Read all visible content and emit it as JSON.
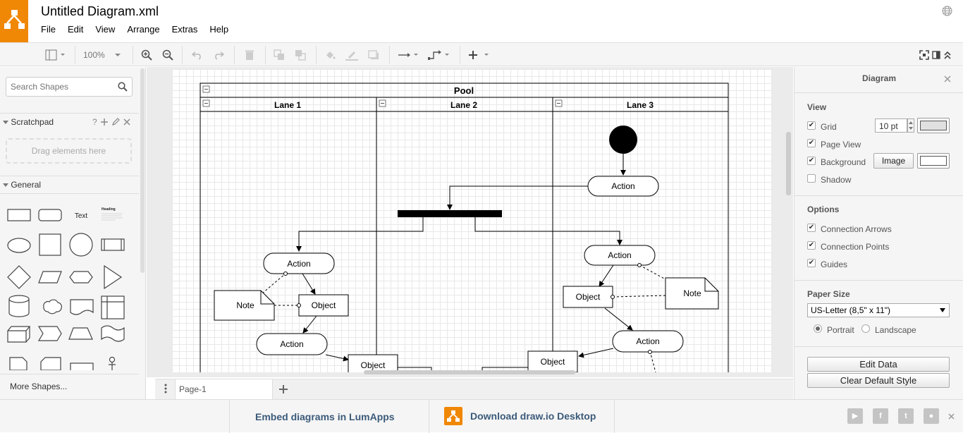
{
  "app": {
    "title": "Untitled Diagram.xml",
    "menu": [
      "File",
      "Edit",
      "View",
      "Arrange",
      "Extras",
      "Help"
    ]
  },
  "toolbar": {
    "zoom": "100%",
    "icons": [
      "format-panel-icon",
      "zoom-in-icon",
      "zoom-out-icon",
      "undo-icon",
      "redo-icon",
      "delete-icon",
      "to-front-icon",
      "to-back-icon",
      "fill-color-icon",
      "line-color-icon",
      "shadow-icon",
      "connection-style-icon",
      "waypoint-icon",
      "insert-icon",
      "fullscreen-icon",
      "collapse-icon"
    ]
  },
  "sidebar": {
    "search_placeholder": "Search Shapes",
    "scratchpad_label": "Scratchpad",
    "scratchpad_help": "?",
    "dropzone": "Drag elements here",
    "general_label": "General",
    "shape_text": "Text",
    "shape_heading": "Heading",
    "more_shapes": "More Shapes..."
  },
  "diagram": {
    "pool": "Pool",
    "lanes": [
      "Lane 1",
      "Lane 2",
      "Lane 3"
    ],
    "labels": {
      "action": "Action",
      "object": "Object",
      "note": "Note"
    }
  },
  "pages": {
    "active_tab": "Page-1"
  },
  "format_panel": {
    "title": "Diagram",
    "view_heading": "View",
    "grid_label": "Grid",
    "grid_checked": true,
    "grid_size": "10 pt",
    "page_view_label": "Page View",
    "page_view_checked": true,
    "background_label": "Background",
    "background_checked": true,
    "image_button": "Image",
    "shadow_label": "Shadow",
    "shadow_checked": false,
    "options_heading": "Options",
    "connection_arrows_label": "Connection Arrows",
    "connection_points_label": "Connection Points",
    "guides_label": "Guides",
    "paper_size_heading": "Paper Size",
    "paper_size_value": "US-Letter (8,5\" x 11\")",
    "portrait_label": "Portrait",
    "landscape_label": "Landscape",
    "orientation": "Portrait",
    "edit_data_button": "Edit Data",
    "clear_style_button": "Clear Default Style"
  },
  "footer": {
    "embed_text": "Embed diagrams in LumApps",
    "download_text": "Download draw.io Desktop",
    "social": [
      "youtube-icon",
      "facebook-icon",
      "twitter-icon",
      "github-icon"
    ]
  },
  "colors": {
    "brand": "#f08705",
    "link": "#3b5a7a"
  }
}
